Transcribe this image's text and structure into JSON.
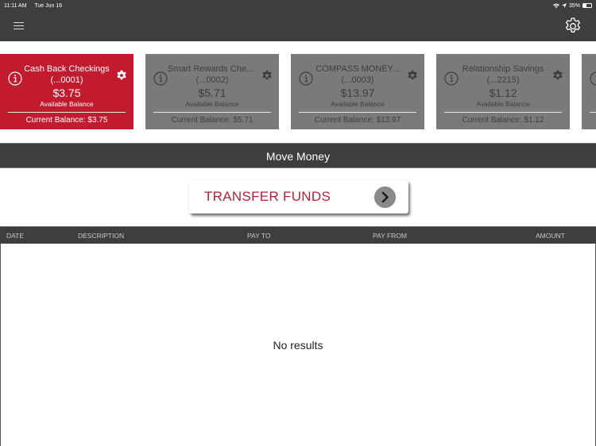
{
  "status_bar": {
    "time": "11:11 AM",
    "date": "Tue Jun 16",
    "battery_percent_label": "35%",
    "battery_level": 0.35,
    "icons": [
      "wifi-icon",
      "location-icon",
      "battery-icon"
    ]
  },
  "nav": {
    "menu_icon": "hamburger-menu-icon",
    "settings_icon": "gear-icon"
  },
  "colors": {
    "header_bg": "#403e3c",
    "active_card": "#c21b2f",
    "inactive_card": "#7a7a7a",
    "transfer_text": "#b5203a"
  },
  "accounts": [
    {
      "name": "Cash Back Checkings",
      "number": "(...0001)",
      "available": "$3.75",
      "available_label": "Available Balance",
      "current": "Current Balance: $3.75",
      "active": true
    },
    {
      "name": "Smart Rewards Chec...",
      "number": "(...0002)",
      "available": "$5.71",
      "available_label": "Available Balance",
      "current": "Current Balance: $5.71",
      "active": false
    },
    {
      "name": "COMPASS MONEY...",
      "number": "(...0003)",
      "available": "$13.97",
      "available_label": "Available Balance",
      "current": "Current Balance: $13.97",
      "active": false
    },
    {
      "name": "Relationship Savings",
      "number": "(...2215)",
      "available": "$1.12",
      "available_label": "Available Balance",
      "current": "Current Balance: $1.12",
      "active": false
    }
  ],
  "section": {
    "title": "Move Money"
  },
  "transfer": {
    "label": "TRANSFER FUNDS"
  },
  "table": {
    "columns": [
      "DATE",
      "DESCRIPTION",
      "PAY TO",
      "PAY FROM",
      "AMOUNT"
    ],
    "rows": [],
    "empty_text": "No results"
  }
}
